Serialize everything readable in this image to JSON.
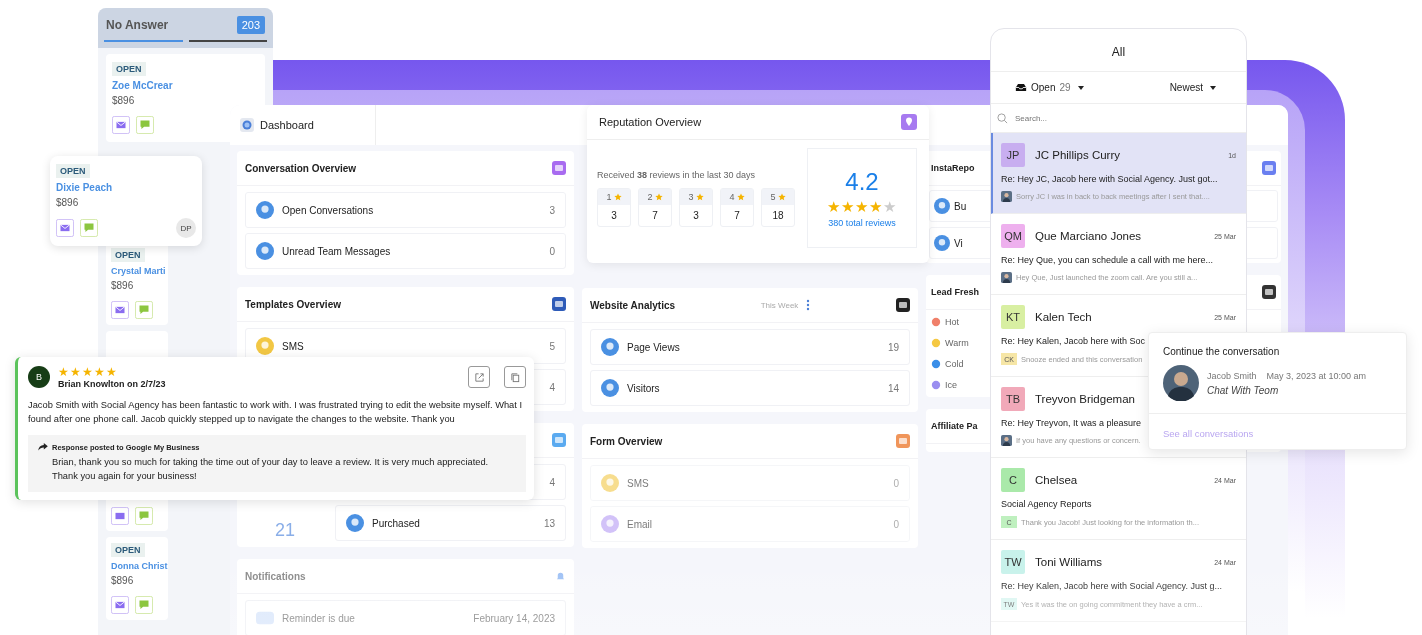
{
  "kanban": {
    "title": "No Answer",
    "count": "203",
    "cards": [
      {
        "kind": "full",
        "status": "OPEN",
        "name": "Zoe McCrear",
        "amount": "$896"
      },
      {
        "kind": "full",
        "status": "OPEN",
        "name": "Crystal Marti",
        "amount": "$896"
      },
      {
        "kind": "icons_only"
      },
      {
        "kind": "full",
        "status": "OPEN",
        "name": "Donna Christ",
        "amount": "$896"
      }
    ]
  },
  "dragged_card": {
    "status": "OPEN",
    "name": "Dixie Peach",
    "amount": "$896",
    "assignee": "DP"
  },
  "dashboard": {
    "tab": "Dashboard",
    "columns": [
      [
        {
          "kind": "conversation",
          "title": "Conversation Overview",
          "rows": [
            {
              "label": "Open Conversations",
              "value": "3"
            },
            {
              "label": "Unread Team Messages",
              "value": "0"
            }
          ]
        },
        {
          "kind": "templates",
          "title": "Templates Overview",
          "rows": [
            {
              "label": "SMS",
              "value": "5"
            },
            {
              "value": "4"
            }
          ]
        },
        {
          "kind": "stats",
          "big_number": "21",
          "rows": [
            {
              "value": "4"
            },
            {
              "label": "Purchased",
              "value": "13"
            }
          ]
        },
        {
          "kind": "notifications",
          "title": "Notifications",
          "rows": [
            {
              "label": "Reminder is due",
              "value": "February 14, 2023"
            }
          ]
        }
      ],
      [
        {
          "kind": "analytics",
          "title": "Website Analytics",
          "period": "This Week",
          "rows": [
            {
              "label": "Page Views",
              "value": "19"
            },
            {
              "label": "Visitors",
              "value": "14"
            }
          ]
        },
        {
          "kind": "form",
          "title": "Form Overview",
          "rows": [
            {
              "label": "SMS",
              "value": "0"
            },
            {
              "label": "Email",
              "value": "0"
            }
          ]
        }
      ],
      [
        {
          "kind": "insta",
          "title": "InstaRepo",
          "rows": [
            {
              "label": "Bu"
            },
            {
              "label": "Vi"
            }
          ]
        },
        {
          "kind": "lead",
          "title": "Lead Fresh",
          "rows": [
            {
              "label": "Hot"
            },
            {
              "label": "Warm"
            },
            {
              "label": "Cold"
            },
            {
              "label": "Ice"
            }
          ]
        },
        {
          "kind": "affiliate",
          "title": "Affiliate Pa"
        }
      ]
    ]
  },
  "reputation": {
    "title": "Reputation Overview",
    "summary": "Received **38** reviews in the last 30 days",
    "breakdown": [
      {
        "stars_label": "1",
        "count": "3"
      },
      {
        "stars_label": "2",
        "count": "7"
      },
      {
        "stars_label": "3",
        "count": "3"
      },
      {
        "stars_label": "4",
        "count": "7"
      },
      {
        "stars_label": "5",
        "count": "18"
      }
    ],
    "rating": "4.2",
    "stars": 4,
    "total": "380 total reviews"
  },
  "review": {
    "avatar": "B",
    "stars": 5,
    "author": "Brian Knowlton on 2/7/23",
    "text": "Jacob Smith with Social Agency has been fantastic to work with. I was frustrated trying to edit the website myself. What I found after one phone call. Jacob quickly stepped up to navigate the changes to the website. Thank you",
    "response_heading": "Response posted to Google My Business",
    "response": "Brian, thank you so much for taking the time out of your day to leave a review. It is very much appreciated. Thank you again for your business!"
  },
  "inbox": {
    "title": "All",
    "filter": "Open",
    "filter_count": "29",
    "sort": "Newest",
    "search": {
      "placeholder": "Search..."
    },
    "conversations": [
      {
        "initials": "JP",
        "color": "#c8aef0",
        "name": "JC Phillips Curry",
        "time": "1d",
        "subject": "Re: Hey JC, Jacob here with Social Agency. Just got...",
        "preview": "Sorry JC I was in back to back meetings after I sent that....",
        "preview_avatar": {
          "kind": "photo"
        },
        "selected": true
      },
      {
        "initials": "QM",
        "color": "#eeb0ee",
        "name": "Que Marciano Jones",
        "time": "25 Mar",
        "subject": "Re: Hey Que, you can schedule a call with me here...",
        "preview": "Hey Que, Just launched the zoom call. Are you still a...",
        "preview_avatar": {
          "kind": "photo"
        },
        "selected": false
      },
      {
        "initials": "KT",
        "color": "#d8efa2",
        "name": "Kalen Tech",
        "time": "25 Mar",
        "subject": "Re: Hey Kalen, Jacob here with Soc",
        "preview": "Snooze ended and this conversation",
        "preview_avatar": {
          "kind": "initials",
          "text": "CK",
          "color": "#f6e6a6"
        },
        "selected": false
      },
      {
        "initials": "TB",
        "color": "#f1a9b9",
        "name": "Treyvon Bridgeman",
        "subject": "Re: Hey Treyvon, It was a pleasure",
        "preview": "If you have any questions or concern.",
        "preview_avatar": {
          "kind": "photo"
        },
        "selected": false
      },
      {
        "initials": "C",
        "color": "#aae9aa",
        "name": "Chelsea",
        "time": "24 Mar",
        "subject": "Social Agency Reports",
        "preview": "Thank you Jacob! Just looking for the information th...",
        "preview_avatar": {
          "kind": "initials",
          "text": "C",
          "color": "#bff0bf"
        },
        "selected": false
      },
      {
        "initials": "TW",
        "color": "#c8f2eb",
        "name": "Toni Williams",
        "time": "24 Mar",
        "subject": "Re: Hey Kalen, Jacob here with Social Agency. Just g...",
        "preview": "Yes it was the on going commitment they have a crm...",
        "preview_avatar": {
          "kind": "initials",
          "text": "TW",
          "color": "#d8f5f0"
        },
        "selected": false
      }
    ]
  },
  "popup": {
    "title": "Continue the conversation",
    "name": "Jacob Smith",
    "date": "May 3, 2023 at 10:00 am",
    "channel": "Chat With Teom",
    "link": "See all conversations"
  }
}
